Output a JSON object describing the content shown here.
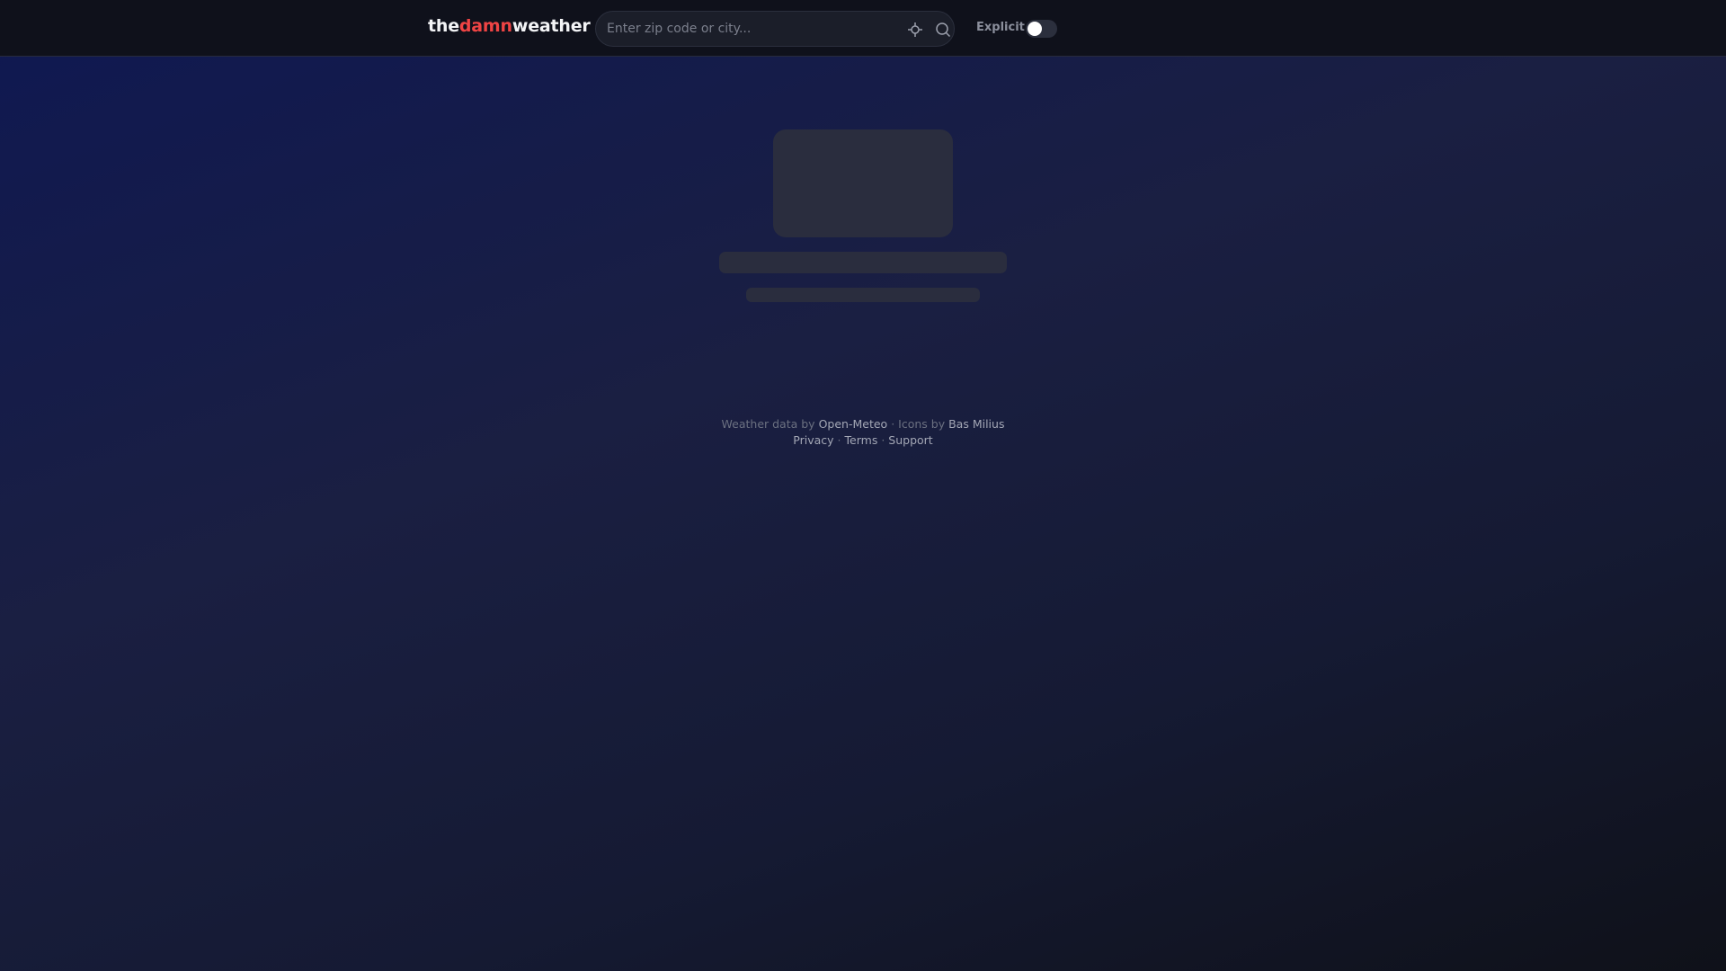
{
  "header": {
    "logo": {
      "part1": "the",
      "part2": "damn",
      "part3": "weather"
    },
    "search": {
      "placeholder": "Enter zip code or city...",
      "value": ""
    },
    "explicit_label": "Explicit",
    "explicit_on": false
  },
  "footer": {
    "weather_prefix": "Weather data by",
    "weather_link": "Open-Meteo",
    "sep": "·",
    "icons_prefix": "Icons by",
    "icons_link": "Bas Milius",
    "privacy": "Privacy",
    "terms": "Terms",
    "support": "Support"
  },
  "colors": {
    "accent": "#ef4444"
  }
}
